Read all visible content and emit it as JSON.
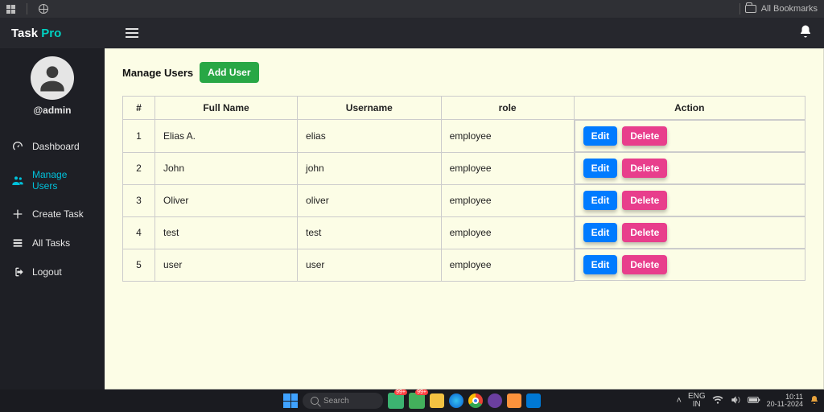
{
  "chrome": {
    "all_bookmarks": "All Bookmarks"
  },
  "header": {
    "brand_a": "Task ",
    "brand_b": "Pro"
  },
  "sidebar": {
    "username": "@admin",
    "items": [
      {
        "label": "Dashboard"
      },
      {
        "label": "Manage Users"
      },
      {
        "label": "Create Task"
      },
      {
        "label": "All Tasks"
      },
      {
        "label": "Logout"
      }
    ]
  },
  "page": {
    "title": "Manage Users",
    "add_user": "Add User"
  },
  "table": {
    "headers": {
      "idx": "#",
      "fullname": "Full Name",
      "username": "Username",
      "role": "role",
      "action": "Action"
    },
    "edit": "Edit",
    "delete": "Delete",
    "rows": [
      {
        "n": "1",
        "fullname": "Elias A.",
        "username": "elias",
        "role": "employee"
      },
      {
        "n": "2",
        "fullname": "John",
        "username": "john",
        "role": "employee"
      },
      {
        "n": "3",
        "fullname": "Oliver",
        "username": "oliver",
        "role": "employee"
      },
      {
        "n": "4",
        "fullname": "test",
        "username": "test",
        "role": "employee"
      },
      {
        "n": "5",
        "fullname": "user",
        "username": "user",
        "role": "employee"
      }
    ]
  },
  "taskbar": {
    "search_placeholder": "Search",
    "badge1": "99+",
    "badge2": "99+",
    "lang": "ENG",
    "region": "IN",
    "time": "10:11",
    "date": "20-11-2024"
  }
}
